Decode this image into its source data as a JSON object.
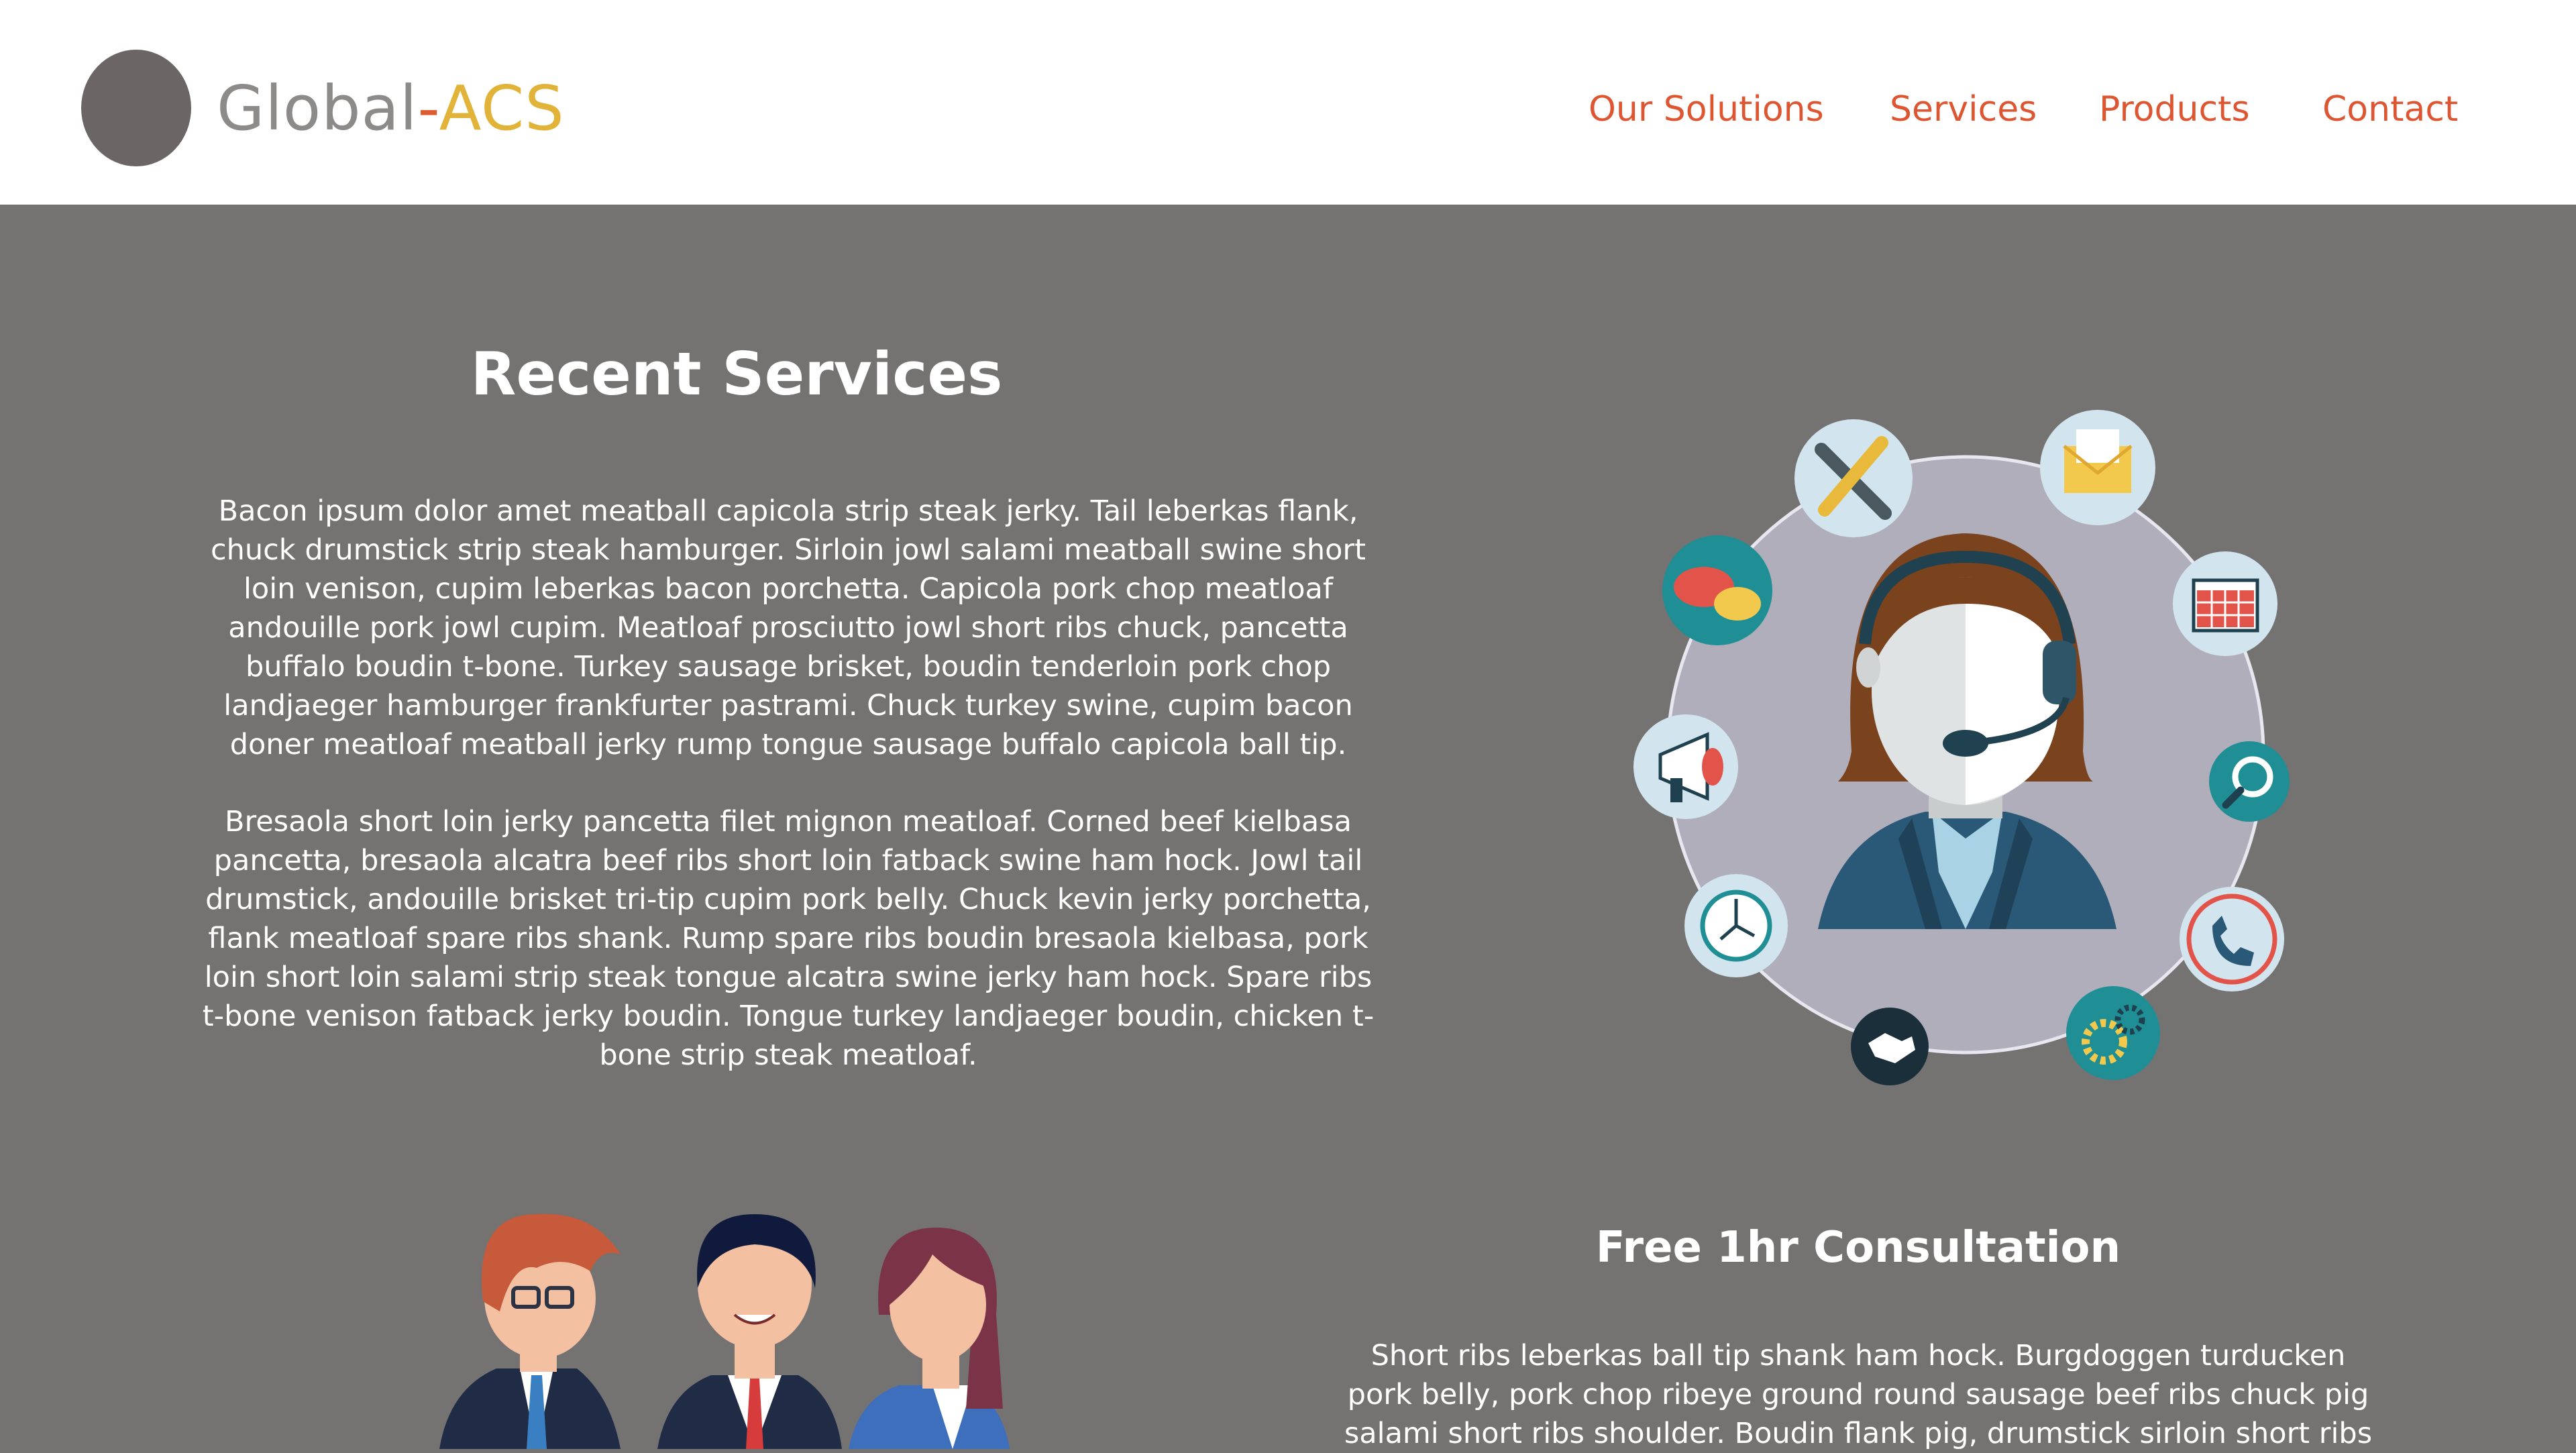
{
  "header": {
    "brand_primary": "Global",
    "brand_dash": "-",
    "brand_accent": "ACS",
    "nav": [
      "Our Solutions",
      "Services",
      "Products",
      "Contact"
    ]
  },
  "recent_services": {
    "title": "Recent Services",
    "paragraph_1": "Bacon ipsum dolor amet meatball capicola strip steak jerky. Tail leberkas flank, chuck drumstick strip steak hamburger. Sirloin jowl salami meatball swine short loin venison, cupim leberkas bacon porchetta. Capicola pork chop meatloaf andouille pork jowl cupim. Meatloaf prosciutto jowl short ribs chuck, pancetta buffalo boudin t-bone. Turkey sausage brisket, boudin tenderloin pork chop landjaeger hamburger frankfurter pastrami. Chuck turkey swine, cupim bacon doner meatloaf meatball jerky rump tongue sausage buffalo capicola ball tip.",
    "paragraph_2": "Bresaola short loin jerky pancetta filet mignon meatloaf. Corned beef kielbasa pancetta, bresaola alcatra beef ribs short loin fatback swine ham hock. Jowl tail drumstick, andouille brisket tri-tip cupim pork belly. Chuck kevin jerky porchetta, flank meatloaf spare ribs shank. Rump spare ribs boudin bresaola kielbasa, pork loin short loin salami strip steak tongue alcatra swine jerky ham hock. Spare ribs t-bone venison fatback jerky boudin. Tongue turkey landjaeger boudin, chicken t-bone strip steak meatloaf."
  },
  "consultation": {
    "title": "Free 1hr Consultation",
    "paragraph": "Short ribs leberkas ball tip shank ham hock. Burgdoggen turducken pork belly, pork chop ribeye ground round sausage beef ribs chuck pig salami short ribs shoulder. Boudin flank pig, drumstick sirloin short ribs"
  },
  "colors": {
    "background": "#757272",
    "header_bg": "#ffffff",
    "nav_text": "#de5631",
    "brand_accent": "#e1b338",
    "brand_primary": "#8d8a8a"
  },
  "icons": [
    "tools-icon",
    "envelope-icon",
    "chat-icon",
    "calendar-icon",
    "megaphone-icon",
    "settings-search-icon",
    "clock-icon",
    "phone-icon",
    "handshake-icon",
    "gears-icon"
  ]
}
